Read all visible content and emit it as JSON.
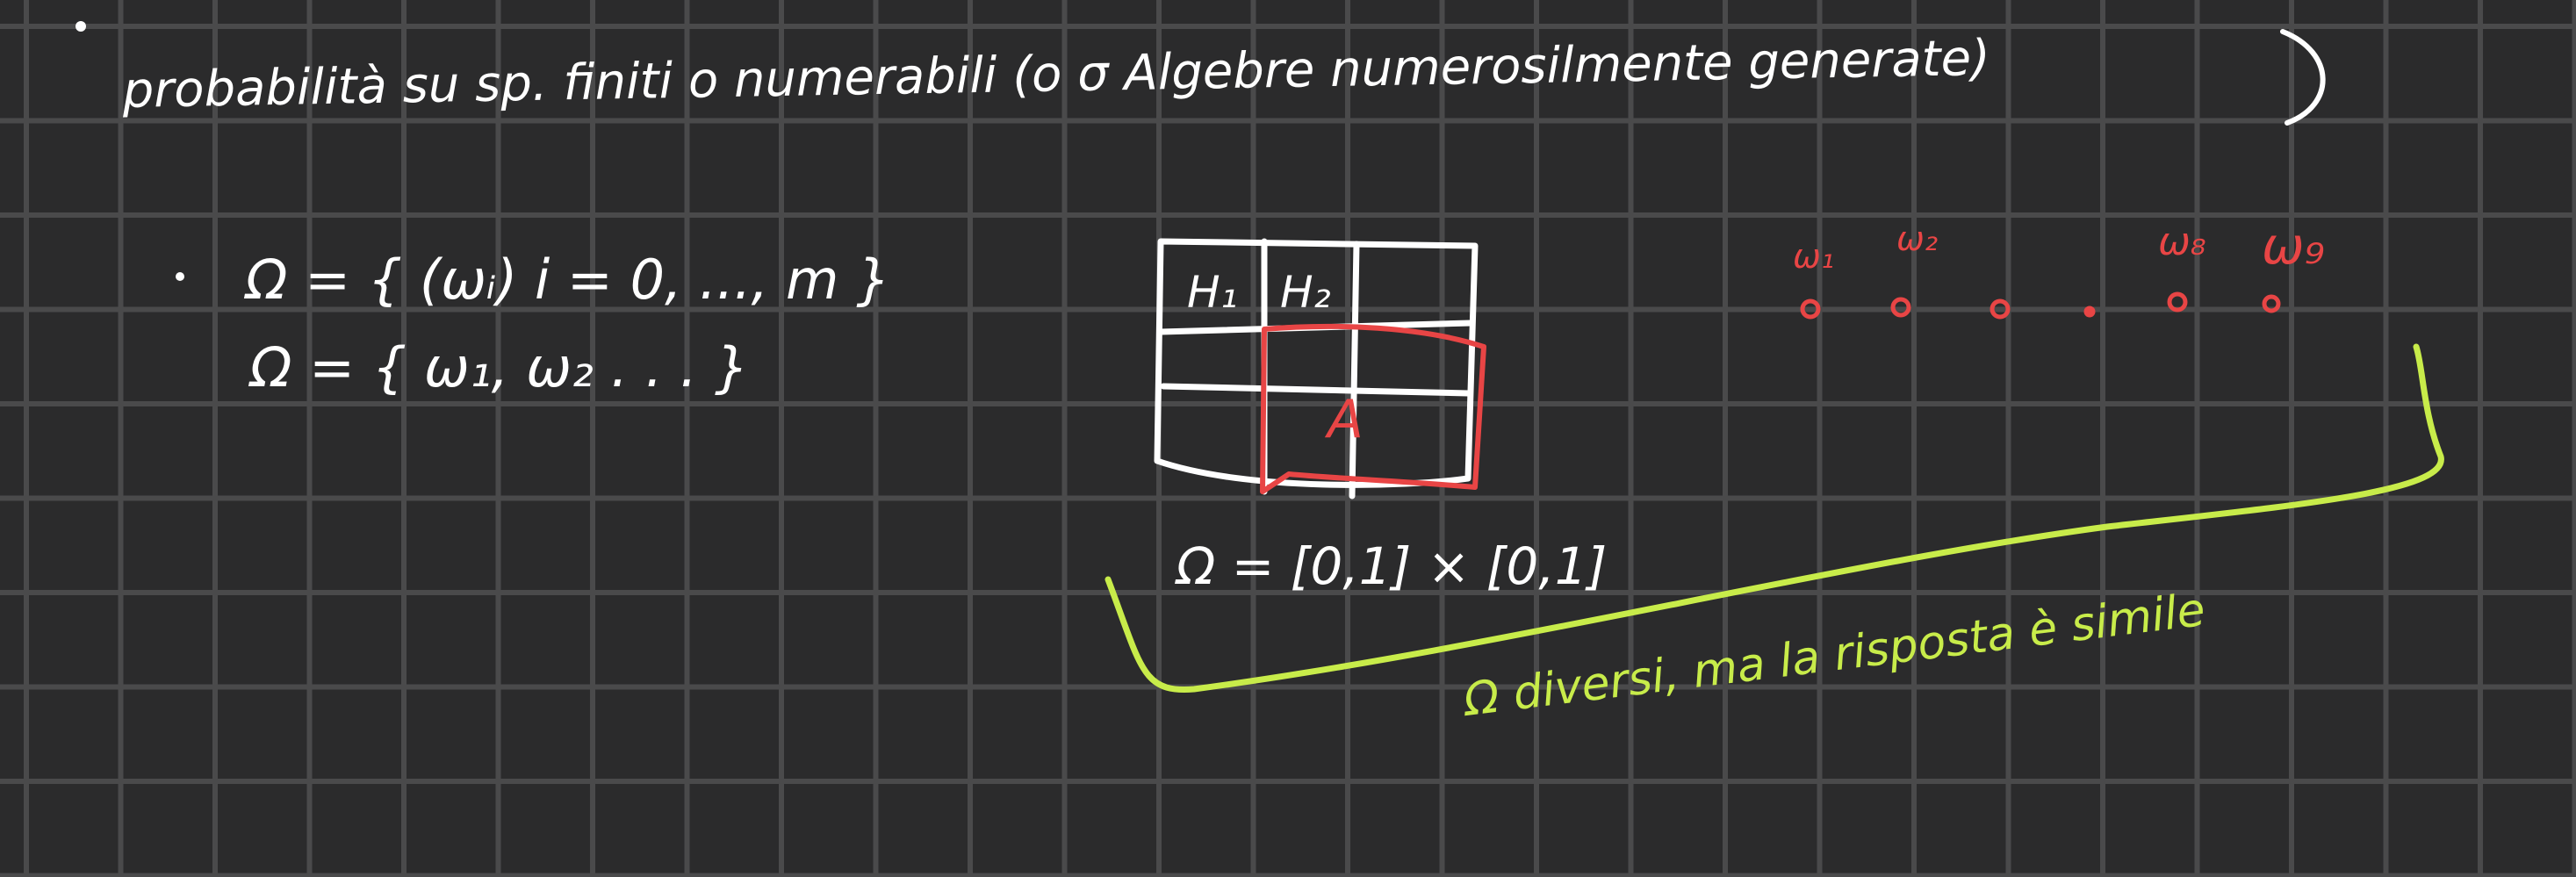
{
  "notes": {
    "heading": "probabilità su sp. finiti o numerabili (o σ Algebre numerosilmente generate)",
    "omega_def_1": "Ω = { (ωᵢ)   i = 0, ..., m }",
    "omega_def_2": "Ω = { ω₁, ω₂ . . . }",
    "grid_cell_h1": "H₁",
    "grid_cell_h2": "H₂",
    "grid_event": "A",
    "grid_caption": "Ω = [0,1] × [0,1]",
    "points_labels": [
      "ω₁",
      "ω₂",
      "ω₈",
      "ω₉"
    ],
    "brace_note": "Ω diversi, ma la risposta è simile"
  },
  "colors": {
    "ink": "#ffffff",
    "red": "#e84545",
    "green": "#c8ec4a",
    "background": "#2b2b2c",
    "grid": "#4a4a4b"
  }
}
